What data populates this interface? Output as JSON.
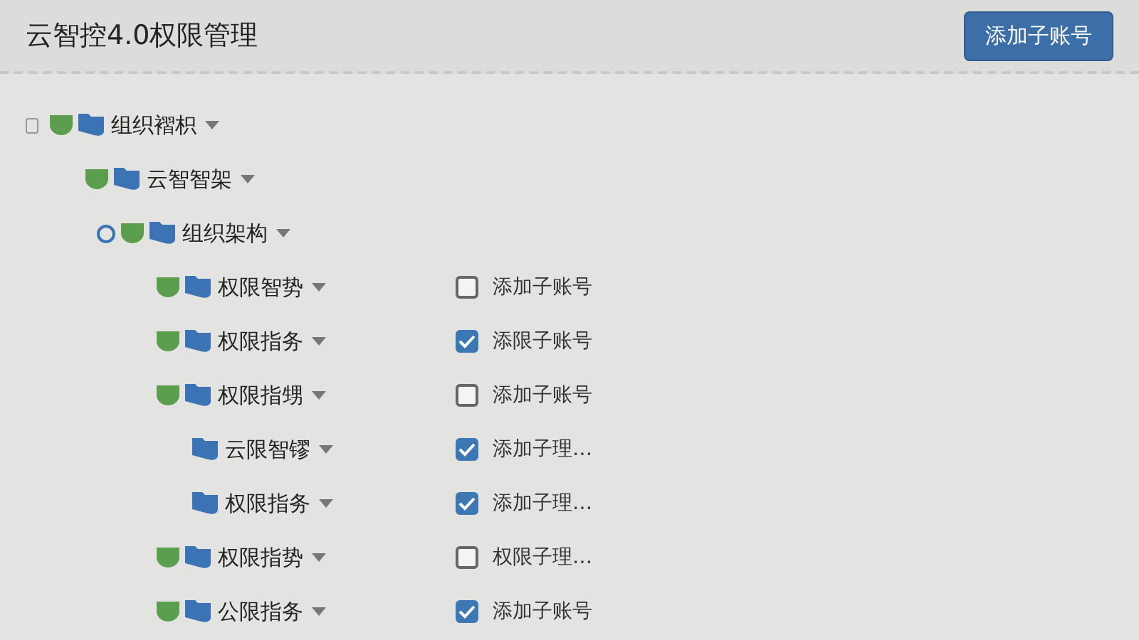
{
  "header": {
    "title": "云智控4.0权限管理",
    "button": "添加子账号"
  },
  "tree": [
    {
      "label": "组织褶枳",
      "kind": "square",
      "shield": true,
      "children": [
        {
          "label": "云智智架",
          "shield": true,
          "children": [
            {
              "label": "组织架构",
              "kind": "circle",
              "shield": true,
              "children": [
                {
                  "label": "权限智势",
                  "shield": true,
                  "permission": {
                    "label": "添加子账号",
                    "checked": false
                  }
                },
                {
                  "label": "权限指务",
                  "shield": true,
                  "permission": {
                    "label": "添限子账号",
                    "checked": true
                  }
                },
                {
                  "label": "权限指甥",
                  "shield": true,
                  "permission": {
                    "label": "添加子账号",
                    "checked": false
                  },
                  "children": [
                    {
                      "label": "云限智镠",
                      "shield": false,
                      "permission": {
                        "label": "添加子理…",
                        "checked": true
                      }
                    },
                    {
                      "label": "权限指务",
                      "shield": false,
                      "permission": {
                        "label": "添加子理…",
                        "checked": true
                      }
                    }
                  ]
                },
                {
                  "label": "权限指势",
                  "shield": true,
                  "permission": {
                    "label": "权限子理…",
                    "checked": false
                  }
                },
                {
                  "label": "公限指务",
                  "shield": true,
                  "permission": {
                    "label": "添加子账号",
                    "checked": true
                  }
                }
              ]
            }
          ]
        }
      ]
    }
  ]
}
